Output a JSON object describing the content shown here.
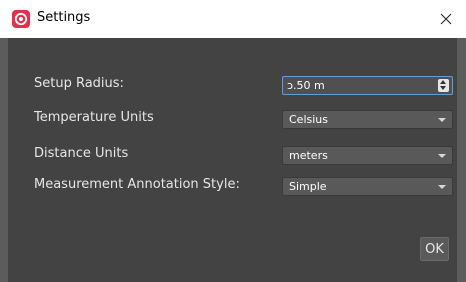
{
  "window": {
    "title": "Settings",
    "accent": "#e0304b"
  },
  "settings": {
    "setup_radius": {
      "label": "Setup Radius:",
      "value": "ɔ.50 m"
    },
    "temperature_units": {
      "label": "Temperature Units",
      "value": "Celsius"
    },
    "distance_units": {
      "label": "Distance Units",
      "value": "meters"
    },
    "annotation_style": {
      "label": "Measurement Annotation Style:",
      "value": "Simple"
    }
  },
  "buttons": {
    "ok_label": "OK"
  }
}
